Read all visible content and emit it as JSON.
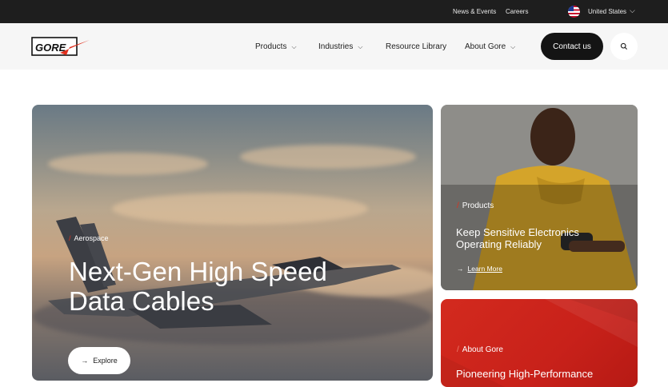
{
  "topbar": {
    "news_events": "News & Events",
    "careers": "Careers",
    "country": "United States",
    "flag_icon": "us-flag-icon"
  },
  "navbar": {
    "logo_text": "GORE",
    "items": [
      {
        "label": "Products",
        "has_dropdown": true
      },
      {
        "label": "Industries",
        "has_dropdown": true
      },
      {
        "label": "Resource Library",
        "has_dropdown": false
      },
      {
        "label": "About Gore",
        "has_dropdown": true
      }
    ],
    "contact_label": "Contact us",
    "search_icon": "search-icon"
  },
  "hero": {
    "kicker": "Aerospace",
    "title_line1": "Next-Gen High Speed",
    "title_line2": "Data Cables",
    "cta_label": "Explore",
    "cta_icon": "arrow-right-icon"
  },
  "cards": [
    {
      "kicker": "Products",
      "title_line1": "Keep Sensitive Electronics",
      "title_line2": "Operating Reliably",
      "link_label": "Learn More"
    },
    {
      "kicker": "About Gore",
      "title_line1": "Pioneering High-Performance"
    }
  ],
  "colors": {
    "accent_red": "#e0301e",
    "topbar_bg": "#1e1e1e",
    "nav_bg": "#f6f6f6",
    "card_red": "#d32a1e"
  }
}
